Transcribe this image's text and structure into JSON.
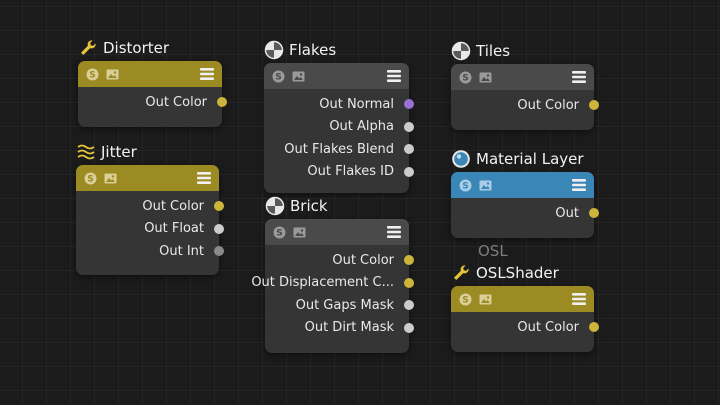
{
  "colors": {
    "yellow": "#cdb43a",
    "header_gold": "#9c8a23",
    "header_gray": "#4a4a4a",
    "header_blue": "#3a86b7",
    "pin_purple": "#9a6fd6",
    "pin_gray": "#cccccc",
    "pin_dark": "#8a8a8a"
  },
  "nodes": {
    "distorter": {
      "title": "Distorter",
      "icon": "wrench-icon",
      "outputs": [
        "Out Color"
      ]
    },
    "jitter": {
      "title": "Jitter",
      "icon": "waves-icon",
      "outputs": [
        "Out Color",
        "Out Float",
        "Out Int"
      ]
    },
    "flakes": {
      "title": "Flakes",
      "icon": "half-sphere-icon",
      "outputs": [
        "Out Normal",
        "Out Alpha",
        "Out Flakes Blend",
        "Out Flakes ID"
      ]
    },
    "brick": {
      "title": "Brick",
      "icon": "half-sphere-icon",
      "outputs": [
        "Out Color",
        "Out Displacement C...",
        "Out Gaps Mask",
        "Out Dirt Mask"
      ]
    },
    "tiles": {
      "title": "Tiles",
      "icon": "half-sphere-icon",
      "outputs": [
        "Out Color"
      ]
    },
    "material_layer": {
      "title": "Material Layer",
      "icon": "material-sphere-icon",
      "outputs": [
        "Out"
      ]
    },
    "oslshader": {
      "group_label": "OSL",
      "title": "OSLShader",
      "icon": "wrench-icon",
      "outputs": [
        "Out Color"
      ]
    }
  }
}
